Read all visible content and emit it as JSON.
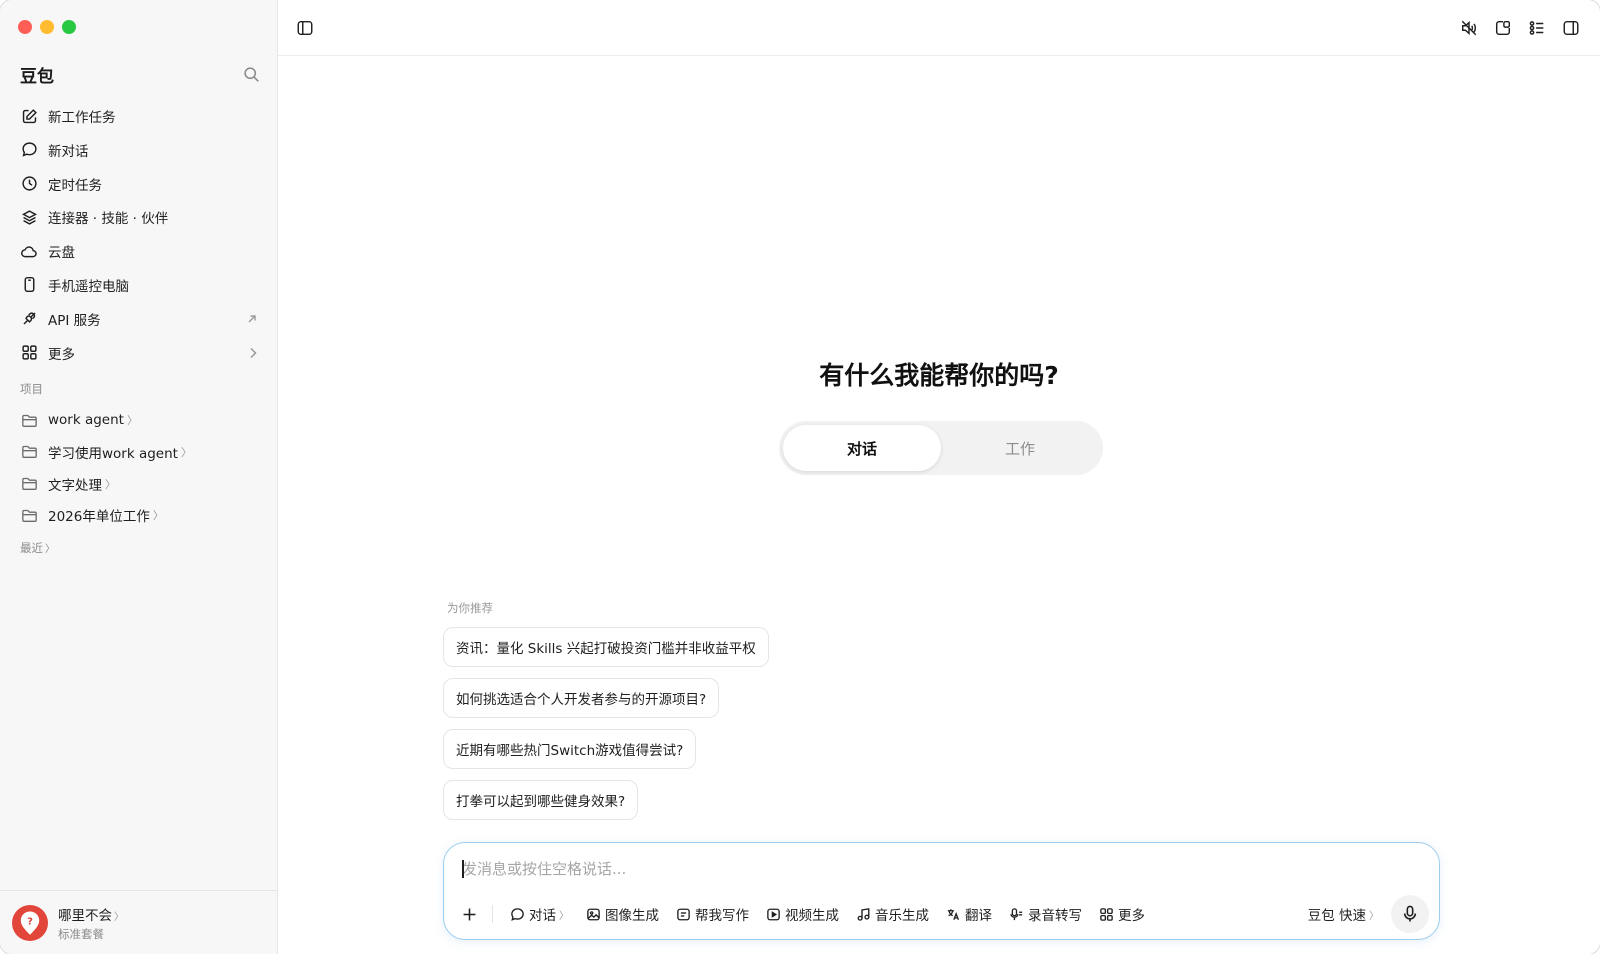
{
  "app": {
    "brand": "豆包"
  },
  "sidebar": {
    "nav": [
      {
        "label": "新工作任务",
        "icon": "edit-icon"
      },
      {
        "label": "新对话",
        "icon": "chat-bubble-icon"
      },
      {
        "label": "定时任务",
        "icon": "clock-icon"
      },
      {
        "label": "连接器 · 技能 · 伙伴",
        "icon": "layers-icon"
      },
      {
        "label": "云盘",
        "icon": "cloud-icon"
      },
      {
        "label": "手机遥控电脑",
        "icon": "phone-icon"
      },
      {
        "label": "API 服务",
        "icon": "api-icon"
      },
      {
        "label": "更多",
        "icon": "grid-icon"
      }
    ],
    "projects_label": "项目",
    "projects": [
      {
        "label": "work agent"
      },
      {
        "label": "学习使用work agent"
      },
      {
        "label": "文字处理"
      },
      {
        "label": "2026年单位工作"
      }
    ],
    "recent_label": "最近",
    "user": {
      "name": "哪里不会",
      "plan": "标准套餐"
    }
  },
  "main": {
    "greeting": "有什么我能帮你的吗?",
    "modes": [
      {
        "label": "对话",
        "active": true
      },
      {
        "label": "工作",
        "active": false
      }
    ],
    "recommend_label": "为你推荐",
    "suggestions": [
      "资讯：量化 Skills 兴起打破投资门槛并非收益平权",
      "如何挑选适合个人开发者参与的开源项目?",
      "近期有哪些热门Switch游戏值得尝试?",
      "打拳可以起到哪些健身效果?"
    ],
    "composer": {
      "placeholder": "发消息或按住空格说话...",
      "tools": [
        {
          "label": "对话",
          "icon": "chat-bubble-icon",
          "dropdown": true
        },
        {
          "label": "图像生成",
          "icon": "image-icon"
        },
        {
          "label": "帮我写作",
          "icon": "writing-icon"
        },
        {
          "label": "视频生成",
          "icon": "video-icon"
        },
        {
          "label": "音乐生成",
          "icon": "music-icon"
        },
        {
          "label": "翻译",
          "icon": "translate-icon"
        },
        {
          "label": "录音转写",
          "icon": "mic-transcribe-icon"
        },
        {
          "label": "更多",
          "icon": "grid-icon"
        }
      ],
      "model": "豆包 快速"
    }
  },
  "colors": {
    "accent_border": "#9ccdf0",
    "avatar": "#e2453a"
  }
}
